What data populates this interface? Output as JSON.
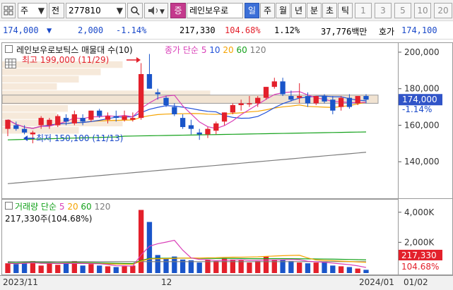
{
  "toolbar": {
    "market_type": "주",
    "code_prefix": "전",
    "stock_code": "277810",
    "flag": "증",
    "stock_name": "레인보우로",
    "periods": [
      "일",
      "주",
      "월",
      "년",
      "분",
      "초",
      "틱"
    ],
    "selected_period": "일",
    "intervals": [
      "1",
      "3",
      "5",
      "10",
      "20"
    ]
  },
  "quote": {
    "price": "174,000",
    "change_arrow": "▼",
    "change": "2,000",
    "change_pct": "-1.14%",
    "volume": "217,330",
    "volume_ratio": "104.68%",
    "turnover": "1.12%",
    "amount": "37,776백만",
    "bid_label": "호가",
    "bid_price": "174,100"
  },
  "price_pane": {
    "title": "레인보우로보틱스 매물대 수(10)",
    "legend_prefix": "종가 단순",
    "ma": [
      "5",
      "10",
      "20",
      "60",
      "120"
    ],
    "colors": {
      "ma5": "#d93fb8",
      "ma10": "#2151d9",
      "ma20": "#f5a300",
      "ma60": "#15a21c",
      "ma120": "#7c7c7c",
      "up": "#e3202b",
      "down": "#1a55c9"
    },
    "high_annot": "최고 199,000 (11/29)",
    "low_annot": "최저 150,100 (11/13)",
    "current_price_label": "174,000",
    "current_change_label": "-1.14%",
    "axis_ticks": [
      "200,000",
      "180,000",
      "160,000",
      "140,000"
    ]
  },
  "volume_pane": {
    "title": "거래량 단순",
    "ma": [
      "5",
      "20",
      "60",
      "120"
    ],
    "value_label": "217,330주(104.68%)",
    "axis_ticks": [
      "4,000K",
      "2,000K"
    ],
    "current_label": "217,330",
    "current_pct": "104.68%"
  },
  "date_axis": {
    "labels": [
      "2023/11",
      "12",
      "2024/01"
    ],
    "cursor_date": "01/02"
  },
  "chart_data": {
    "type": "candlestick",
    "ylim": [
      120000,
      205000
    ],
    "candles": [
      [
        158000,
        163000,
        154000,
        163000
      ],
      [
        160000,
        162000,
        157000,
        158000
      ],
      [
        158000,
        160000,
        155000,
        156000
      ],
      [
        155000,
        157000,
        150100,
        156000
      ],
      [
        160000,
        165000,
        158000,
        164000
      ],
      [
        160000,
        164000,
        158000,
        163000
      ],
      [
        160000,
        166000,
        159000,
        165000
      ],
      [
        164000,
        166000,
        160000,
        162000
      ],
      [
        161000,
        168000,
        160000,
        166000
      ],
      [
        164000,
        166000,
        160000,
        162000
      ],
      [
        163000,
        168000,
        162000,
        168000
      ],
      [
        168000,
        169000,
        164000,
        165000
      ],
      [
        163000,
        167000,
        161000,
        165000
      ],
      [
        165000,
        168000,
        162000,
        164000
      ],
      [
        163000,
        168000,
        162000,
        165000
      ],
      [
        163000,
        167000,
        162000,
        164000
      ],
      [
        164000,
        194000,
        163000,
        188000
      ],
      [
        188000,
        199000,
        180000,
        180000
      ],
      [
        178000,
        180000,
        174000,
        177000
      ],
      [
        175000,
        176000,
        170000,
        171000
      ],
      [
        170000,
        172000,
        165000,
        166000
      ],
      [
        164000,
        166000,
        158000,
        159000
      ],
      [
        160000,
        163000,
        155000,
        158000
      ],
      [
        156000,
        158000,
        152000,
        155000
      ],
      [
        155000,
        159000,
        153000,
        158000
      ],
      [
        157000,
        162000,
        155000,
        161000
      ],
      [
        162000,
        167000,
        160000,
        167000
      ],
      [
        167000,
        172000,
        166000,
        171000
      ],
      [
        171000,
        174000,
        168000,
        172000
      ],
      [
        172000,
        176000,
        170000,
        172000
      ],
      [
        172000,
        176000,
        170000,
        175000
      ],
      [
        175000,
        181000,
        174000,
        181000
      ],
      [
        181000,
        186000,
        180000,
        184000
      ],
      [
        184000,
        186000,
        176000,
        177000
      ],
      [
        176000,
        179000,
        173000,
        174000
      ],
      [
        175000,
        183000,
        172000,
        176000
      ],
      [
        176000,
        178000,
        170000,
        172000
      ],
      [
        172000,
        176000,
        171000,
        176000
      ],
      [
        176000,
        177000,
        172000,
        173000
      ],
      [
        174000,
        176000,
        166000,
        168000
      ],
      [
        170000,
        176000,
        168000,
        175000
      ],
      [
        175000,
        177000,
        169000,
        170000
      ],
      [
        172000,
        176000,
        171000,
        176000
      ],
      [
        176000,
        177000,
        172000,
        174000
      ]
    ],
    "volume": [
      650,
      600,
      700,
      800,
      500,
      650,
      550,
      700,
      800,
      500,
      600,
      500,
      450,
      400,
      450,
      500,
      4200,
      3400,
      1200,
      1000,
      1100,
      900,
      850,
      700,
      900,
      800,
      1000,
      900,
      850,
      700,
      800,
      1100,
      900,
      900,
      800,
      700,
      650,
      700,
      750,
      500,
      450,
      400,
      300,
      217
    ],
    "volume_ylim": [
      0,
      4600
    ]
  }
}
